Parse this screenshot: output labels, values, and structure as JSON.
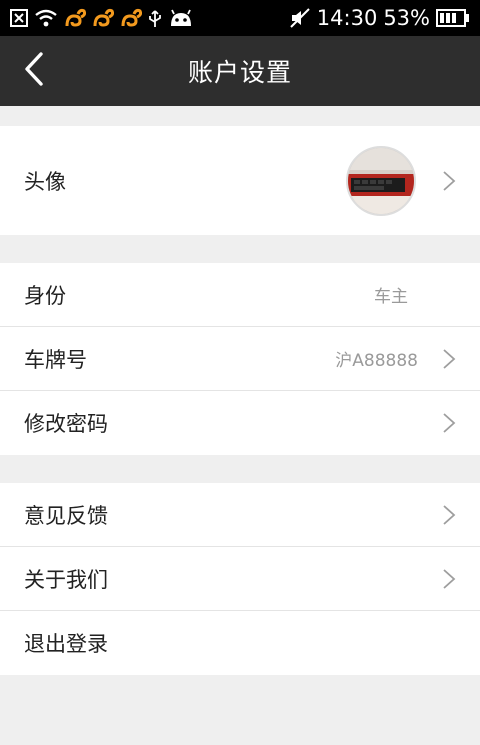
{
  "status_bar": {
    "time": "14:30",
    "battery_percent": "53%",
    "icons": [
      "notification-x-icon",
      "wifi-icon",
      "squirrel-app-icon",
      "squirrel-app-icon",
      "squirrel-app-icon",
      "usb-icon",
      "android-icon",
      "mute-icon",
      "battery-icon"
    ]
  },
  "nav": {
    "title": "账户设置",
    "back_icon": "chevron-left-icon"
  },
  "groups": [
    {
      "rows": [
        {
          "label": "头像",
          "value": "",
          "has_chevron": true,
          "avatar": true
        }
      ]
    },
    {
      "rows": [
        {
          "label": "身份",
          "value": "车主",
          "has_chevron": false
        },
        {
          "label": "车牌号",
          "value": "沪A88888",
          "has_chevron": true
        },
        {
          "label": "修改密码",
          "value": "",
          "has_chevron": true
        }
      ]
    },
    {
      "rows": [
        {
          "label": "意见反馈",
          "value": "",
          "has_chevron": true
        },
        {
          "label": "关于我们",
          "value": "",
          "has_chevron": true
        },
        {
          "label": "退出登录",
          "value": "",
          "has_chevron": false
        }
      ]
    }
  ]
}
